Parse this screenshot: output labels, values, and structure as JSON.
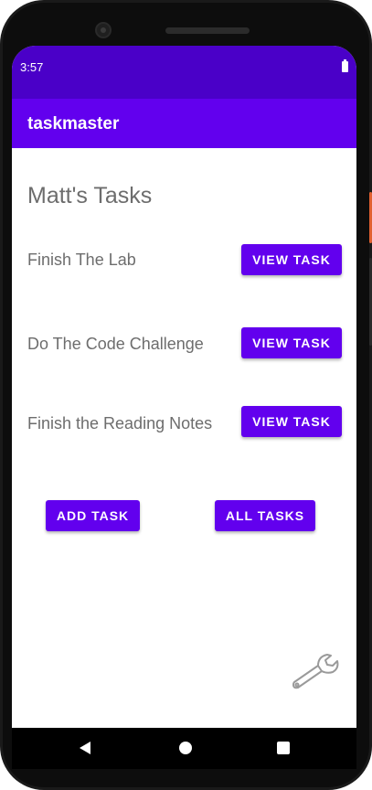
{
  "status_bar": {
    "time": "3:57"
  },
  "app_bar": {
    "title": "taskmaster"
  },
  "main": {
    "page_title": "Matt's Tasks",
    "tasks": [
      {
        "label": "Finish The Lab",
        "button": "VIEW TASK"
      },
      {
        "label": "Do The Code Challenge",
        "button": "VIEW TASK"
      },
      {
        "label": "Finish the Reading Notes",
        "button": "VIEW TASK"
      }
    ],
    "add_task_label": "ADD TASK",
    "all_tasks_label": "ALL TASKS",
    "settings_icon": "wrench-icon"
  },
  "colors": {
    "status_bar": "#4a00c8",
    "app_bar": "#6200ee",
    "button": "#6200ee",
    "text": "#6d6d6d"
  },
  "nav_bar": {
    "icons": [
      "back-icon",
      "home-icon",
      "recents-icon"
    ]
  }
}
